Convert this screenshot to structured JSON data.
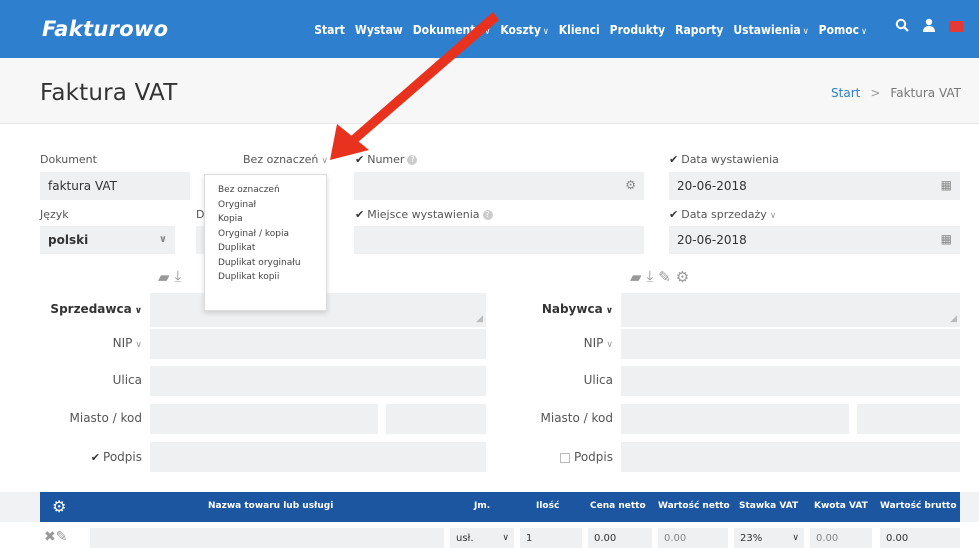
{
  "app": {
    "logo": "Fakturowo"
  },
  "nav": {
    "items": [
      {
        "label": "Start",
        "chev": ""
      },
      {
        "label": "Wystaw",
        "chev": ""
      },
      {
        "label": "Dokumenty",
        "chev": "∨"
      },
      {
        "label": "Koszty",
        "chev": "∨"
      },
      {
        "label": "Klienci",
        "chev": ""
      },
      {
        "label": "Produkty",
        "chev": ""
      },
      {
        "label": "Raporty",
        "chev": ""
      },
      {
        "label": "Ustawienia",
        "chev": "∨"
      },
      {
        "label": "Pomoc",
        "chev": "∨"
      }
    ]
  },
  "header": {
    "title": "Faktura VAT",
    "breadcrumb_home": "Start",
    "breadcrumb_sep": ">",
    "breadcrumb_current": "Faktura VAT"
  },
  "form": {
    "dokument_label": "Dokument",
    "dokument_value": "faktura VAT",
    "oznaczenie_label": "Bez oznaczeń",
    "numer_label": "Numer",
    "data_wystawienia_label": "Data wystawienia",
    "data_wystawienia_value": "20-06-2018",
    "jezyk_label": "Język",
    "jezyk_value": "polski",
    "d_label": "D",
    "miejsce_label": "Miejsce wystawienia",
    "data_sprzedazy_label": "Data sprzedaży",
    "data_sprzedazy_value": "20-06-2018",
    "sprzedawca_label": "Sprzedawca",
    "nabywca_label": "Nabywca",
    "nip_label": "NIP",
    "ulica_label": "Ulica",
    "miasto_label": "Miasto / kod",
    "podpis_label": "Podpis"
  },
  "dropdown": {
    "options": [
      "Bez oznaczeń",
      "Oryginał",
      "Kopia",
      "Oryginał / kopia",
      "Duplikat",
      "Duplikat oryginału",
      "Duplikat kopii"
    ]
  },
  "table": {
    "headers": {
      "name": "Nazwa towaru lub usługi",
      "unit": "Jm.",
      "qty": "Ilość",
      "net_price": "Cena netto",
      "net_value": "Wartość netto",
      "vat_rate": "Stawka VAT",
      "vat_amount": "Kwota VAT",
      "gross_value": "Wartość brutto"
    },
    "row": {
      "unit": "usł.",
      "qty": "1",
      "net_price": "0.00",
      "net_value": "0.00",
      "vat_rate": "23%",
      "vat_amount": "0.00",
      "gross_value": "0.00"
    }
  },
  "colors": {
    "navbar": "#2e7fce",
    "table_header": "#1c56a1",
    "annotation_arrow": "#e8321e"
  },
  "icons": [
    "search-icon",
    "user-icon",
    "flag-icon",
    "gear-icon",
    "calendar-icon",
    "folder-open-icon",
    "download-icon",
    "edit-icon",
    "delete-icon",
    "info-icon"
  ]
}
